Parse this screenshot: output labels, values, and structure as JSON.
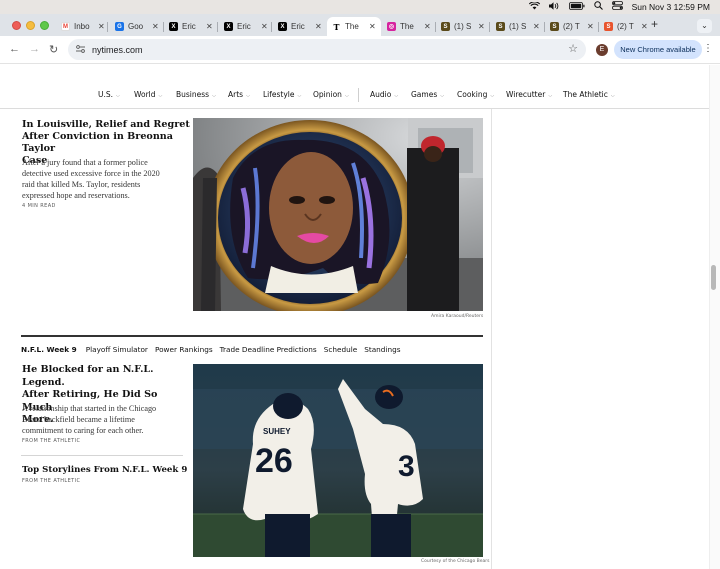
{
  "menubar": {
    "clock": "Sun Nov 3  12:59 PM",
    "icons": [
      "wifi-icon",
      "volume-icon",
      "battery-icon",
      "search-icon",
      "control-center-icon"
    ]
  },
  "tabs": [
    {
      "label": "Inbo",
      "favicon_letter": "M",
      "favicon_color": "#ea4335"
    },
    {
      "label": "Goo",
      "favicon_letter": "G",
      "favicon_color": "#1a73e8"
    },
    {
      "label": "Eric",
      "favicon_letter": "X",
      "favicon_color": "#000000"
    },
    {
      "label": "Eric",
      "favicon_letter": "X",
      "favicon_color": "#000000"
    },
    {
      "label": "Eric",
      "favicon_letter": "X",
      "favicon_color": "#000000"
    },
    {
      "label": "The",
      "favicon_letter": "T",
      "favicon_color": "#000000",
      "active": true
    },
    {
      "label": "The",
      "favicon_letter": "◎",
      "favicon_color": "#d6249f"
    },
    {
      "label": "(1) S",
      "favicon_letter": "S",
      "favicon_color": "#5a4a1a"
    },
    {
      "label": "(1) S",
      "favicon_letter": "S",
      "favicon_color": "#5a4a1a"
    },
    {
      "label": "(2) T",
      "favicon_letter": "S",
      "favicon_color": "#5a4a1a"
    },
    {
      "label": "(2) T",
      "favicon_letter": "S",
      "favicon_color": "#e8542d"
    }
  ],
  "toolbar": {
    "url": "nytimes.com",
    "avatar_letter": "E",
    "update_label": "New Chrome available"
  },
  "nav": {
    "items": [
      "U.S.",
      "World",
      "Business",
      "Arts",
      "Lifestyle",
      "Opinion",
      "Audio",
      "Games",
      "Cooking",
      "Wirecutter",
      "The Athletic"
    ]
  },
  "story1": {
    "headline_lines": [
      "In Louisville, Relief and Regret",
      "After Conviction in Breonna Taylor",
      "Case"
    ],
    "summary_lines": [
      "After a jury found that a former police",
      "detective used excessive force in the 2020",
      "raid that killed Ms. Taylor, residents",
      "expressed hope and reservations."
    ],
    "read_time": "4 MIN READ",
    "photo_credit": "Amira Karaoud/Reuters"
  },
  "section": {
    "title": "N.F.L. Week 9",
    "links": [
      "Playoff Simulator",
      "Power Rankings",
      "Trade Deadline Predictions",
      "Schedule",
      "Standings"
    ]
  },
  "story2": {
    "headline_lines": [
      "He Blocked for an N.F.L. Legend.",
      "After Retiring, He Did So Much",
      "More."
    ],
    "summary_lines": [
      "A relationship that started in the Chicago",
      "Bears' backfield became a lifetime",
      "commitment to caring for each other."
    ],
    "source": "FROM THE ATHLETIC",
    "jersey_name": "SUHEY",
    "jersey_number_left": "26",
    "jersey_number_right": "3",
    "photo_credit": "Courtesy of the Chicago Bears"
  },
  "story3": {
    "headline": "Top Storylines From N.F.L. Week 9",
    "source": "FROM THE ATHLETIC"
  }
}
